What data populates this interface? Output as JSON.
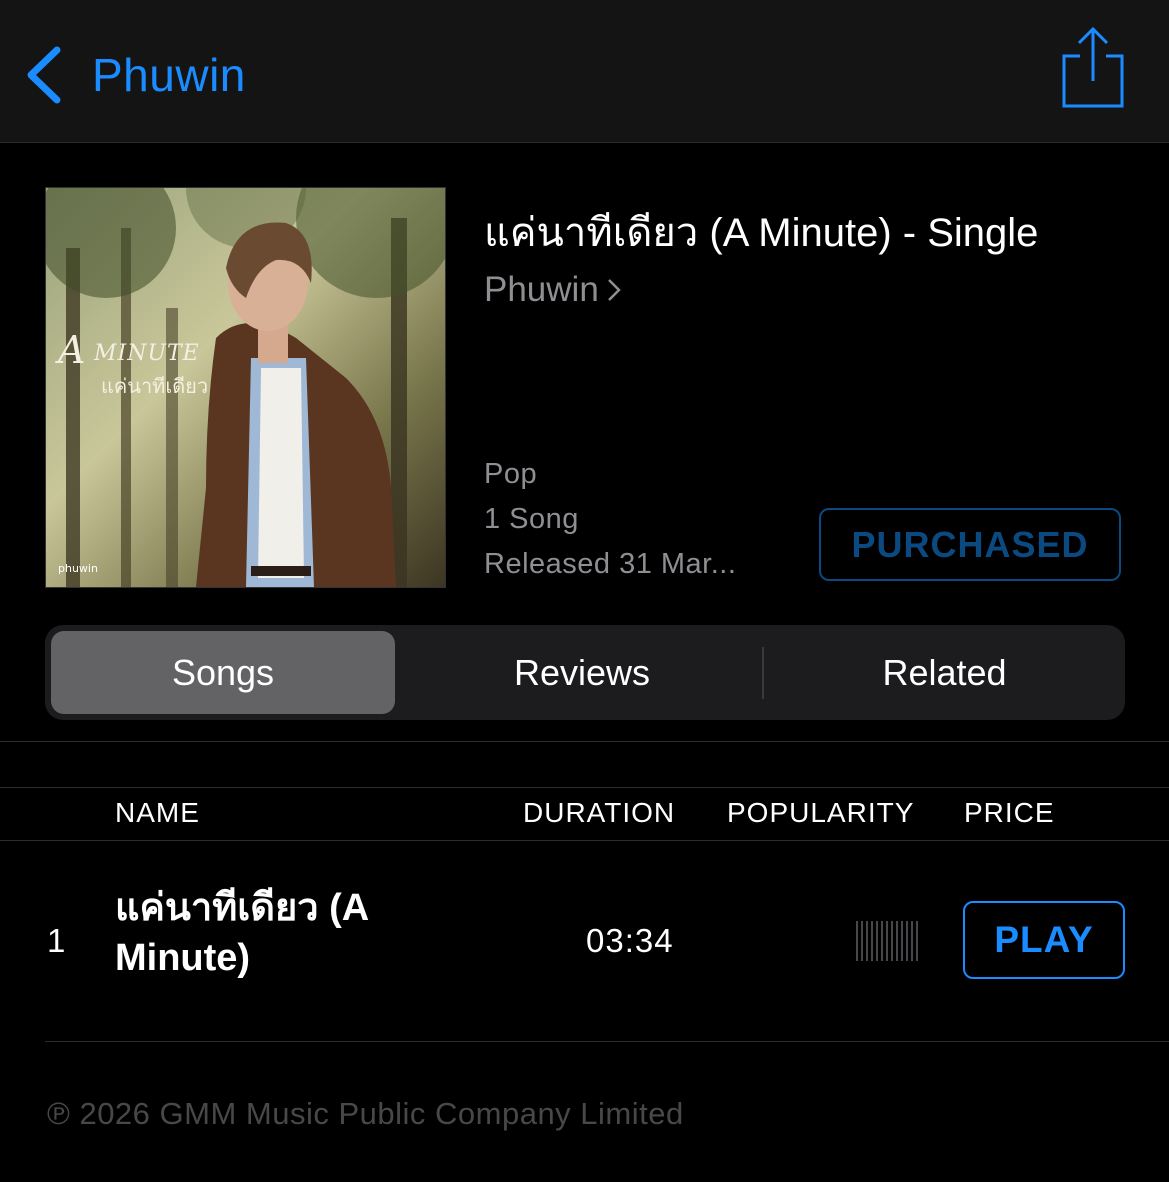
{
  "nav": {
    "back_label": "Phuwin",
    "accent_color": "#1a8cff"
  },
  "album": {
    "title": "แค่นาทีเดียว (A Minute) - Single",
    "artist": "Phuwin",
    "genre": "Pop",
    "song_count": "1 Song",
    "released": "Released 31 Mar...",
    "purchased_label": "PURCHASED",
    "artwork": {
      "title_script": "A MINUTE",
      "title_thai": "แค่นาทีเดียว",
      "brand": "phuwin"
    }
  },
  "segments": {
    "items": [
      "Songs",
      "Reviews",
      "Related"
    ],
    "selected": "Songs"
  },
  "table": {
    "headers": {
      "name": "NAME",
      "duration": "DURATION",
      "popularity": "POPULARITY",
      "price": "PRICE"
    },
    "rows": [
      {
        "number": "1",
        "title": "แค่นาทีเดียว (A Minute)",
        "duration": "03:34",
        "popularity": 0,
        "action_label": "PLAY"
      }
    ]
  },
  "footer": {
    "copyright": "℗ 2026 GMM Music Public Company Limited"
  }
}
